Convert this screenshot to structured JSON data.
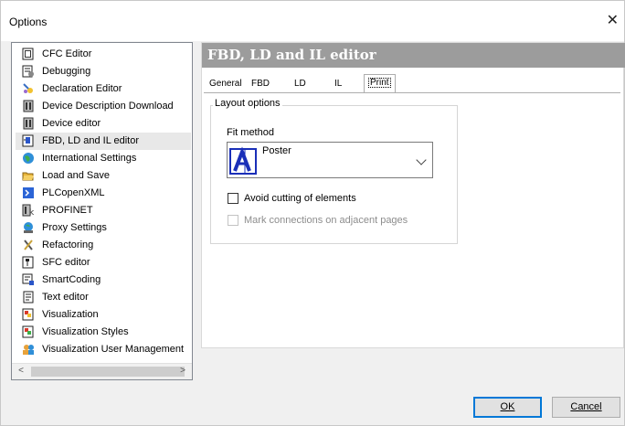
{
  "window": {
    "title": "Options",
    "close_glyph": "✕"
  },
  "tree": {
    "items": [
      {
        "label": "CFC Editor",
        "icon": "cfc-editor-icon"
      },
      {
        "label": "Debugging",
        "icon": "debugging-icon"
      },
      {
        "label": "Declaration Editor",
        "icon": "declaration-editor-icon"
      },
      {
        "label": "Device Description Download",
        "icon": "device-description-icon"
      },
      {
        "label": "Device editor",
        "icon": "device-editor-icon"
      },
      {
        "label": "FBD, LD and IL editor",
        "icon": "fbd-editor-icon",
        "selected": true
      },
      {
        "label": "International Settings",
        "icon": "globe-icon"
      },
      {
        "label": "Load and Save",
        "icon": "folder-icon"
      },
      {
        "label": "PLCopenXML",
        "icon": "plcopenxml-icon"
      },
      {
        "label": "PROFINET",
        "icon": "profinet-icon"
      },
      {
        "label": "Proxy Settings",
        "icon": "proxy-icon"
      },
      {
        "label": "Refactoring",
        "icon": "refactoring-icon"
      },
      {
        "label": "SFC editor",
        "icon": "sfc-editor-icon"
      },
      {
        "label": "SmartCoding",
        "icon": "smartcoding-icon"
      },
      {
        "label": "Text editor",
        "icon": "text-editor-icon"
      },
      {
        "label": "Visualization",
        "icon": "visualization-icon"
      },
      {
        "label": "Visualization Styles",
        "icon": "visualization-styles-icon"
      },
      {
        "label": "Visualization User Management",
        "icon": "user-management-icon"
      }
    ],
    "scroll_left": "<",
    "scroll_right": ">"
  },
  "panel": {
    "header": "FBD, LD and IL editor",
    "tabs": [
      {
        "label": "General"
      },
      {
        "label": "FBD"
      },
      {
        "label": "LD"
      },
      {
        "label": "IL"
      },
      {
        "label": "Print",
        "active": true
      }
    ],
    "group_label": "Layout options",
    "fit_method_label": "Fit method",
    "fit_method_value": "Poster",
    "avoid_cutting_label": "Avoid cutting of elements",
    "avoid_cutting_checked": false,
    "mark_connections_label": "Mark connections on adjacent pages",
    "mark_connections_enabled": false
  },
  "buttons": {
    "ok": "OK",
    "cancel": "Cancel"
  },
  "colors": {
    "header_bg": "#9c9c9c",
    "selected_bg": "#e8e8e8",
    "accent": "#0078d7"
  }
}
